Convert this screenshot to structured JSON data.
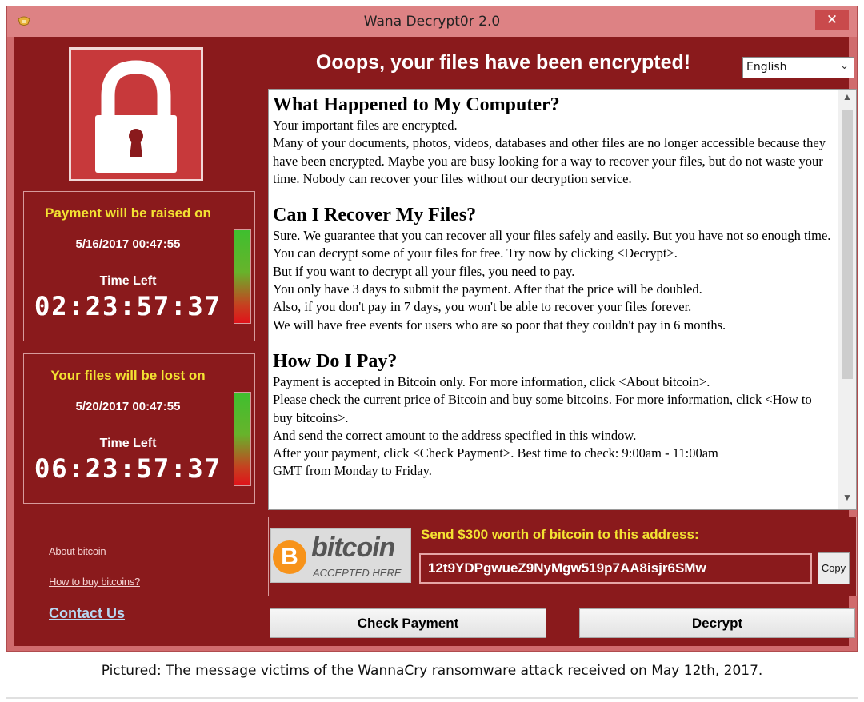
{
  "window": {
    "title": "Wana Decrypt0r 2.0",
    "close_glyph": "✕"
  },
  "heading": "Ooops, your files have been encrypted!",
  "language": {
    "selected": "English"
  },
  "timers": [
    {
      "headline": "Payment will be raised on",
      "date": "5/16/2017 00:47:55",
      "label": "Time Left",
      "countdown": "02:23:57:37"
    },
    {
      "headline": "Your files will be lost on",
      "date": "5/20/2017 00:47:55",
      "label": "Time Left",
      "countdown": "06:23:57:37"
    }
  ],
  "links": {
    "about_bitcoin": "About bitcoin",
    "how_to_buy": "How to buy bitcoins?",
    "contact": "Contact Us"
  },
  "message": {
    "sections": [
      {
        "title": "What Happened to My Computer?",
        "lines": [
          "Your important files are encrypted.",
          "Many of your documents, photos, videos, databases and other files are no longer accessible because they have been encrypted. Maybe you are busy looking for a way to recover your files, but do not waste your time. Nobody can recover your files without our decryption service."
        ]
      },
      {
        "title": "Can I Recover My Files?",
        "lines": [
          "Sure. We guarantee that you can recover all your files safely and easily. But you have not so enough time.",
          "You can decrypt some of your files for free. Try now by clicking <Decrypt>.",
          "But if you want to decrypt all your files, you need to pay.",
          "You only have 3 days to submit the payment. After that the price will be doubled.",
          "Also, if you don't pay in 7 days, you won't be able to recover your files forever.",
          "We will have free events for users who are so poor that they couldn't pay in 6 months."
        ]
      },
      {
        "title": "How Do I Pay?",
        "lines": [
          "Payment is accepted in Bitcoin only. For more information, click <About bitcoin>.",
          "Please check the current price of Bitcoin and buy some bitcoins. For more information, click <How to buy bitcoins>.",
          "And send the correct amount to the address specified in this window.",
          "After your payment, click <Check Payment>. Best time to check: 9:00am - 11:00am",
          "GMT from Monday to Friday."
        ]
      }
    ]
  },
  "payment": {
    "badge_symbol": "B",
    "badge_word": "bitcoin",
    "badge_caption": "ACCEPTED HERE",
    "send_label": "Send $300 worth of bitcoin to this address:",
    "address": "12t9YDPgwueZ9NyMgw519p7AA8isjr6SMw",
    "copy_label": "Copy"
  },
  "buttons": {
    "check_payment": "Check Payment",
    "decrypt": "Decrypt"
  },
  "caption": "Pictured: The message victims of the WannaCry ransomware attack received on May 12th, 2017."
}
